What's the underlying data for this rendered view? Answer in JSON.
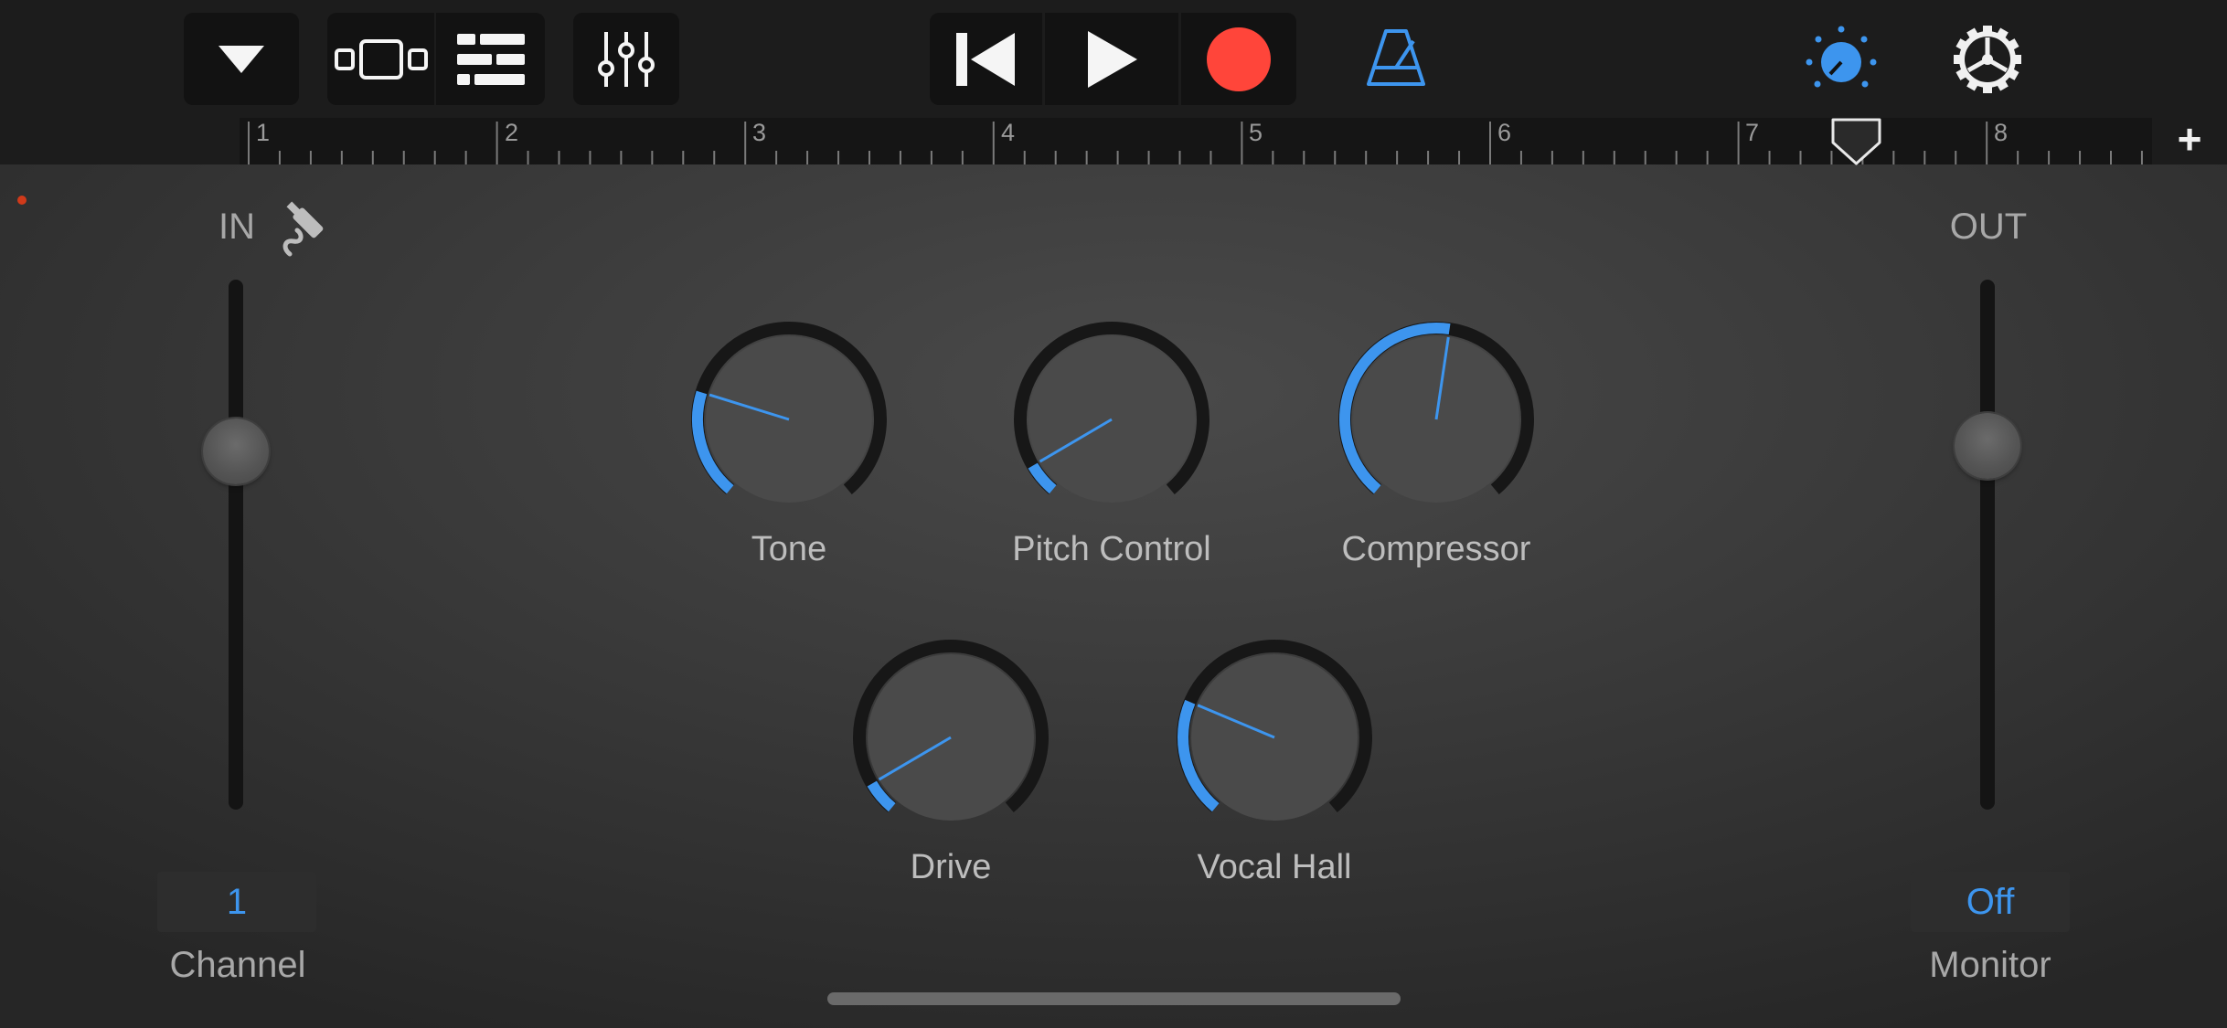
{
  "colors": {
    "accent": "#3d95ee",
    "record": "#ff453a",
    "background": "#333333",
    "toolbar": "#1c1c1c"
  },
  "toolbar": {
    "buttons": [
      {
        "name": "menu-dropdown",
        "icon": "chevron-down-icon"
      },
      {
        "name": "tracks-view",
        "icon": "tracks-view-icon"
      },
      {
        "name": "browser-view",
        "icon": "list-view-icon"
      },
      {
        "name": "mixer",
        "icon": "sliders-icon"
      },
      {
        "name": "go-to-beginning",
        "icon": "skip-back-icon"
      },
      {
        "name": "play",
        "icon": "play-icon"
      },
      {
        "name": "record",
        "icon": "record-icon"
      },
      {
        "name": "metronome",
        "icon": "metronome-icon"
      },
      {
        "name": "master-effects",
        "icon": "knob-icon"
      },
      {
        "name": "settings",
        "icon": "gear-icon"
      }
    ]
  },
  "ruler": {
    "bars": [
      "1",
      "2",
      "3",
      "4",
      "5",
      "6",
      "7",
      "8"
    ],
    "add_section_label": "+"
  },
  "input": {
    "label": "IN",
    "icon": "input-jack-icon",
    "level": 0.65,
    "channel_value": "1",
    "channel_label": "Channel"
  },
  "output": {
    "label": "OUT",
    "level": 0.66,
    "monitor_value": "Off",
    "monitor_label": "Monitor"
  },
  "knobs": [
    {
      "name": "tone",
      "label": "Tone",
      "value": 0.24
    },
    {
      "name": "pitch-control",
      "label": "Pitch Control",
      "value": 0.07
    },
    {
      "name": "compressor",
      "label": "Compressor",
      "value": 0.53
    },
    {
      "name": "drive",
      "label": "Drive",
      "value": 0.07
    },
    {
      "name": "vocal-hall",
      "label": "Vocal Hall",
      "value": 0.26
    }
  ]
}
